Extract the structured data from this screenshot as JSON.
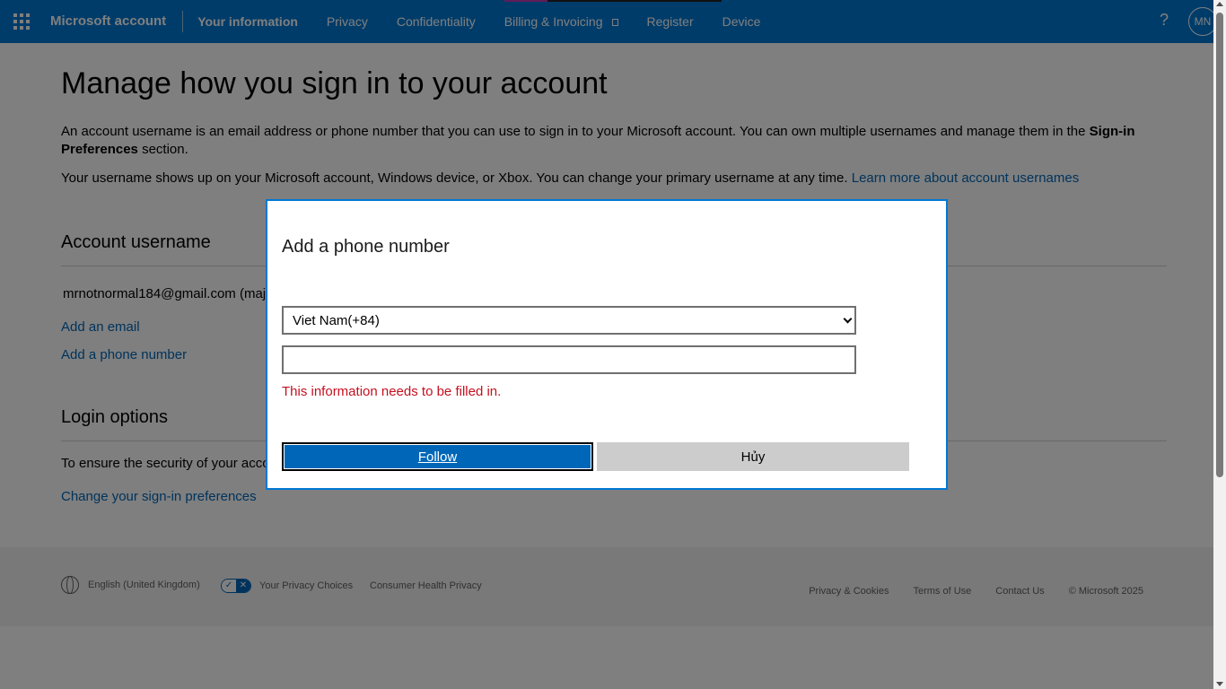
{
  "nav": {
    "brand": "Microsoft account",
    "items": [
      {
        "label": "Your information"
      },
      {
        "label": "Privacy"
      },
      {
        "label": "Confidentiality"
      },
      {
        "label": "Billing & Invoicing"
      },
      {
        "label": "Register"
      },
      {
        "label": "Device"
      }
    ],
    "help": "?",
    "avatar_initials": "MN"
  },
  "page": {
    "title": "Manage how you sign in to your account",
    "intro_part1": "An account username is an email address or phone number that you can use to sign in to your Microsoft account. You can own multiple usernames and manage them in the ",
    "intro_bold": "Sign-in Preferences",
    "intro_part2": " section.",
    "username_info": "Your username shows up on your Microsoft account, Windows device, or Xbox. You can change your primary username at any time. ",
    "learn_more": "Learn more about account usernames"
  },
  "account_username": {
    "title": "Account username",
    "email": "mrnotnormal184@gmail.com (maj",
    "add_email": "Add an email",
    "add_phone": "Add a phone number"
  },
  "login_options": {
    "title": "Login options",
    "text": "To ensure the security of your acco",
    "change_link": "Change your sign-in preferences"
  },
  "footer": {
    "language": "English (United Kingdom)",
    "privacy_choices": "Your Privacy Choices",
    "health_privacy": "Consumer Health Privacy",
    "links": [
      "Privacy & Cookies",
      "Terms of Use",
      "Contact Us",
      "© Microsoft 2025"
    ]
  },
  "dialog": {
    "title": "Add a phone number",
    "country_selected": "Viet Nam(+84)",
    "phone_value": "",
    "error": "This information needs to be filled in.",
    "primary_button": "Follow",
    "secondary_button": "Hủy"
  },
  "colors": {
    "nav_bg": "#0078d4",
    "link": "#0067b8",
    "error": "#c50f1f"
  }
}
